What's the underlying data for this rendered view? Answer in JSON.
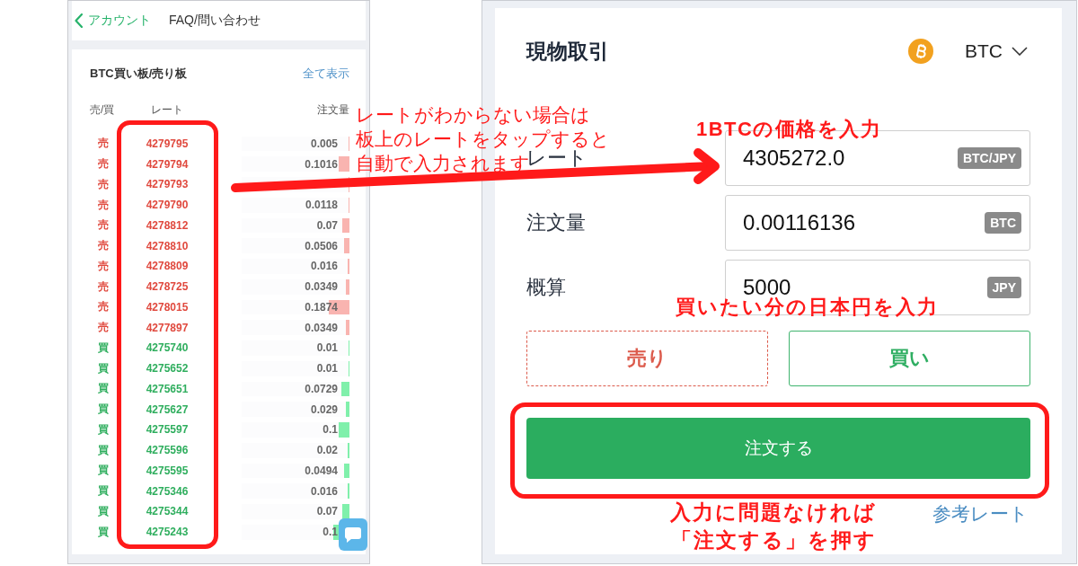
{
  "order_book_screen": {
    "nav": {
      "back_label": "アカウント",
      "title": "FAQ/問い合わせ"
    },
    "book": {
      "title": "BTC買い板/売り板",
      "show_all": "全て表示",
      "columns": [
        "売/買",
        "レート",
        "注文量"
      ],
      "rows": [
        {
          "kind": "sell",
          "side": "売",
          "rate": "4279795",
          "amount": "0.005",
          "level": 0.008
        },
        {
          "kind": "sell",
          "side": "売",
          "rate": "4279794",
          "amount": "0.1016",
          "level": 0.1
        },
        {
          "kind": "sell",
          "side": "売",
          "rate": "4279793",
          "level": 0.012
        },
        {
          "kind": "sell",
          "side": "売",
          "rate": "4279790",
          "amount": "0.0118",
          "level": 0.012
        },
        {
          "kind": "sell",
          "side": "売",
          "rate": "4278812",
          "amount": "0.07",
          "level": 0.07
        },
        {
          "kind": "sell",
          "side": "売",
          "rate": "4278810",
          "amount": "0.0506",
          "level": 0.05
        },
        {
          "kind": "sell",
          "side": "売",
          "rate": "4278809",
          "amount": "0.016",
          "level": 0.016
        },
        {
          "kind": "sell",
          "side": "売",
          "rate": "4278725",
          "amount": "0.0349",
          "level": 0.035
        },
        {
          "kind": "sell",
          "side": "売",
          "rate": "4278015",
          "amount": "0.1874",
          "level": 0.19
        },
        {
          "kind": "sell",
          "side": "売",
          "rate": "4277897",
          "amount": "0.0349",
          "level": 0.035
        },
        {
          "kind": "buy",
          "side": "買",
          "rate": "4275740",
          "amount": "0.01",
          "level": 0.01
        },
        {
          "kind": "buy",
          "side": "買",
          "rate": "4275652",
          "amount": "0.01",
          "level": 0.01
        },
        {
          "kind": "buy",
          "side": "買",
          "rate": "4275651",
          "amount": "0.0729",
          "level": 0.075
        },
        {
          "kind": "buy",
          "side": "買",
          "rate": "4275627",
          "amount": "0.029",
          "level": 0.03
        },
        {
          "kind": "buy",
          "side": "買",
          "rate": "4275597",
          "amount": "0.1",
          "level": 0.1
        },
        {
          "kind": "buy",
          "side": "買",
          "rate": "4275596",
          "amount": "0.02",
          "level": 0.02
        },
        {
          "kind": "buy",
          "side": "買",
          "rate": "4275595",
          "amount": "0.0494",
          "level": 0.05
        },
        {
          "kind": "buy",
          "side": "買",
          "rate": "4275346",
          "amount": "0.016",
          "level": 0.016
        },
        {
          "kind": "buy",
          "side": "買",
          "rate": "4275344",
          "amount": "0.07",
          "level": 0.07
        },
        {
          "kind": "buy",
          "side": "買",
          "rate": "4275243",
          "amount": "0.1",
          "level": 0.15
        }
      ]
    }
  },
  "trade_screen": {
    "title": "現物取引",
    "currency": "BTC",
    "fields": [
      {
        "label": "レート",
        "value": "4305272.0",
        "unit": "BTC/JPY"
      },
      {
        "label": "注文量",
        "value": "0.00116136",
        "unit": "BTC"
      },
      {
        "label": "概算",
        "value": "5000",
        "unit": "JPY"
      }
    ],
    "sides": [
      {
        "kind": "sell",
        "label": "売り",
        "selected": false
      },
      {
        "kind": "buy",
        "label": "買い",
        "selected": true
      }
    ],
    "submit": "注文する",
    "reference_link": "参考レート"
  },
  "annotations": {
    "rate_tap_hint": [
      "レートがわからない場合は",
      "板上のレートをタップすると",
      "自動で入力されます"
    ],
    "price_hint": "1BTCの価格を入力",
    "amount_hint": "買いたい分の日本円を入力",
    "submit_hint": [
      "入力に問題なければ",
      "「注文する」を押す"
    ]
  }
}
